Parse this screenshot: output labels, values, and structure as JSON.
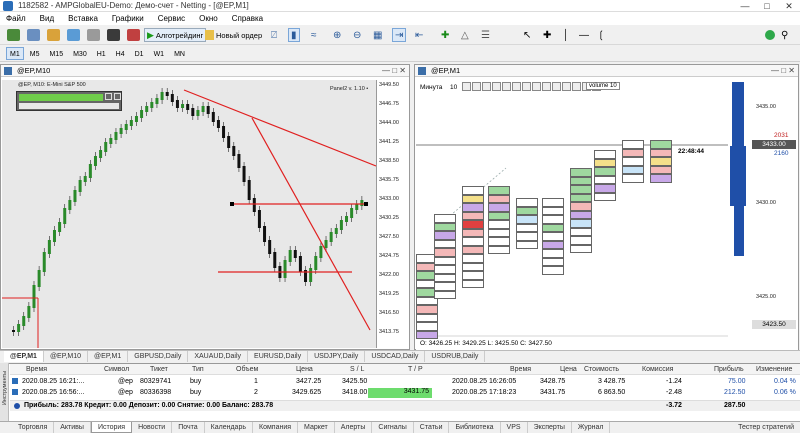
{
  "window": {
    "title": "1182582 - AMPGlobalEU-Demo: Демо-счет - Netting - [@EP,M1]"
  },
  "menu": [
    "Файл",
    "Вид",
    "Вставка",
    "Графики",
    "Сервис",
    "Окно",
    "Справка"
  ],
  "toolbar": {
    "algo_label": "Алготрейдинг",
    "new_order_label": "Новый ордер"
  },
  "timeframes": [
    "M1",
    "M5",
    "M15",
    "M30",
    "H1",
    "H4",
    "D1",
    "W1",
    "MN"
  ],
  "timeframe_active": "M1",
  "left_chart": {
    "title": "@EP,M10",
    "subtitle": "@EP, M10:  E-Mini S&P 500",
    "panel_label": "Panel2  v. 1.10 •",
    "prices": [
      "3449.50",
      "3446.75",
      "3444.00",
      "3441.25",
      "3438.50",
      "3435.75",
      "3433.00",
      "3430.25",
      "3427.50",
      "3424.75",
      "3422.00",
      "3419.25",
      "3416.50",
      "3413.75"
    ]
  },
  "right_chart": {
    "title": "@EP,M1",
    "minute_label": "Минута",
    "minute_value": "10",
    "volume_label": "volume",
    "volume_value": "10",
    "prices": [
      "3435.00",
      "3430.00",
      "3425.00"
    ],
    "high_label": "2031",
    "current_price": "3433.00",
    "low_label": "2160",
    "bottom_price": "3423.50",
    "timer": "22:48:44",
    "ohlc": "O: 3426.25  H: 3429.25  L: 3425.50  C: 3427.50"
  },
  "chart_tabs": [
    "@EP,M1",
    "@EP,M10",
    "@EP,M1",
    "GBPUSD,Daily",
    "XAUAUD,Daily",
    "EURUSD,Daily",
    "USDJPY,Daily",
    "USDCAD,Daily",
    "USDRUB,Daily"
  ],
  "toolbox": {
    "headers": {
      "time": "Время",
      "symbol": "Символ",
      "ticket": "Тикет",
      "type": "Тип",
      "volume": "Объем",
      "price": "Цена",
      "sl": "S / L",
      "tp": "T / P",
      "close_time": "Время",
      "close_price": "Цена",
      "cost": "Стоимость",
      "commission": "Комиссия",
      "profit": "Прибыль",
      "change": "Изменение"
    },
    "rows": [
      {
        "time": "2020.08.25 16:21:...",
        "symbol": "@ep",
        "ticket": "80329741",
        "type": "buy",
        "volume": "1",
        "price": "3427.25",
        "sl": "3425.50",
        "tp": "",
        "close_time": "2020.08.25 16:26:05",
        "close_price": "3428.75",
        "cost": "3 428.75",
        "commission": "-1.24",
        "profit": "75.00",
        "change": "0.04 %"
      },
      {
        "time": "2020.08.25 16:56:...",
        "symbol": "@ep",
        "ticket": "80336398",
        "type": "buy",
        "volume": "2",
        "price": "3429.625",
        "sl": "3418.00",
        "tp": "3431.75",
        "close_time": "2020.08.25 17:18:23",
        "close_price": "3431.75",
        "cost": "6 863.50",
        "commission": "-2.48",
        "profit": "212.50",
        "change": "0.06 %"
      }
    ],
    "summary": "Прибыль: 283.78  Кредит: 0.00  Депозит: 0.00  Снятие: 0.00  Баланс: 283.78",
    "total_commission": "-3.72",
    "total_profit": "287.50"
  },
  "bottom_tabs": [
    "Торговля",
    "Активы",
    "История",
    "Новости",
    "Почта",
    "Календарь",
    "Компания",
    "Маркет",
    "Алерты",
    "Сигналы",
    "Статьи",
    "Библиотека",
    "VPS",
    "Эксперты",
    "Журнал"
  ],
  "bottom_active": "История",
  "strategy_tester": "Тестер стратегий",
  "side_label": "Инструменты",
  "colors": {
    "accent": "#2a6db8",
    "sell_red": "#e03030",
    "tp_green": "#6ddc6d",
    "blue_text": "#1f4fa8"
  }
}
